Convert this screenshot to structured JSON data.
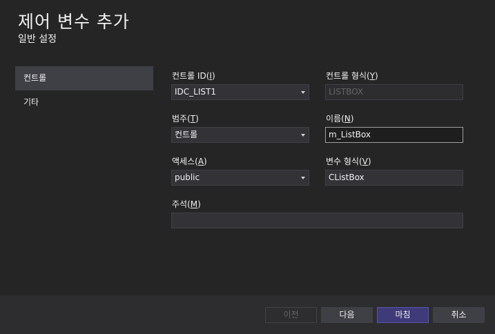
{
  "header": {
    "title": "제어 변수 추가",
    "subtitle": "일반 설정"
  },
  "nav": {
    "items": [
      {
        "label": "컨트롤",
        "selected": true
      },
      {
        "label": "기타",
        "selected": false
      }
    ]
  },
  "form": {
    "control_id": {
      "label": "컨트롤 ID",
      "mnemonic": "I",
      "value": "IDC_LIST1"
    },
    "control_type": {
      "label": "컨트롤 형식",
      "mnemonic": "Y",
      "value": "LISTBOX"
    },
    "category": {
      "label": "범주",
      "mnemonic": "T",
      "value": "컨트롤"
    },
    "name": {
      "label": "이름",
      "mnemonic": "N",
      "value": "m_ListBox"
    },
    "access": {
      "label": "액세스",
      "mnemonic": "A",
      "value": "public"
    },
    "variable_type": {
      "label": "변수 형식",
      "mnemonic": "V",
      "value": "CListBox"
    },
    "comment": {
      "label": "주석",
      "mnemonic": "M",
      "value": ""
    }
  },
  "footer": {
    "prev_label": "이전",
    "next_label": "다음",
    "finish_label": "마침",
    "cancel_label": "취소"
  },
  "colors": {
    "background": "#252526",
    "selected_nav": "#3f3f46",
    "primary_button": "#3f3a7a"
  }
}
